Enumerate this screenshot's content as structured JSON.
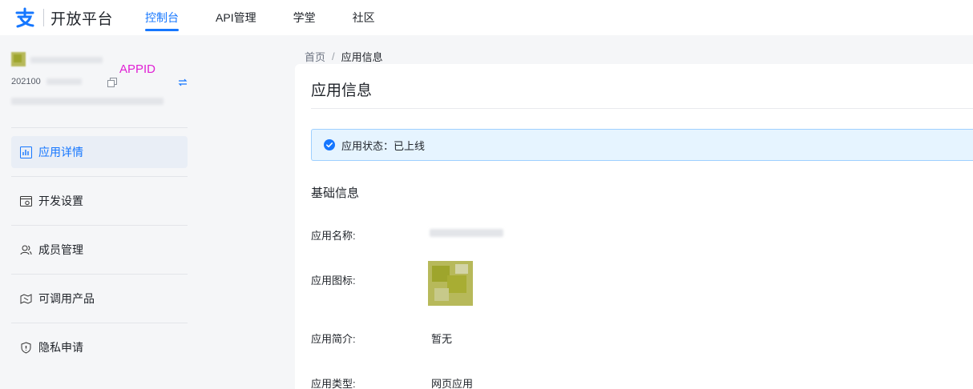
{
  "brand": {
    "name": "开放平台",
    "logo": "alipay-logo"
  },
  "nav": [
    {
      "label": "控制台",
      "active": true
    },
    {
      "label": "API管理",
      "active": false
    },
    {
      "label": "学堂",
      "active": false
    },
    {
      "label": "社区",
      "active": false
    }
  ],
  "app_card": {
    "appid_annotation": "APPID",
    "appid_prefix": "202100",
    "icons": [
      "copy-icon",
      "swap-icon"
    ]
  },
  "sidebar": {
    "items": [
      {
        "label": "应用详情",
        "icon": "chart-icon",
        "active": true
      },
      {
        "label": "开发设置",
        "icon": "settings-window-icon",
        "active": false
      },
      {
        "label": "成员管理",
        "icon": "members-icon",
        "active": false
      },
      {
        "label": "可调用产品",
        "icon": "products-icon",
        "active": false
      },
      {
        "label": "隐私申请",
        "icon": "shield-icon",
        "active": false
      }
    ]
  },
  "breadcrumb": {
    "home": "首页",
    "separator": "/",
    "current": "应用信息"
  },
  "page": {
    "title": "应用信息",
    "status": {
      "label": "应用状态：已上线",
      "icon": "check-circle-icon",
      "color": "#1677ff"
    },
    "section_title": "基础信息",
    "fields": {
      "name_label": "应用名称:",
      "icon_label": "应用图标:",
      "intro_label": "应用简介:",
      "intro_value": "暂无",
      "type_label": "应用类型:",
      "type_value": "网页应用"
    }
  },
  "colors": {
    "accent": "#1677ff",
    "annotation": "#e020d4",
    "status_bg": "#e6f4ff",
    "status_border": "#9ed0ff",
    "app_icon": "#9ea52c"
  }
}
